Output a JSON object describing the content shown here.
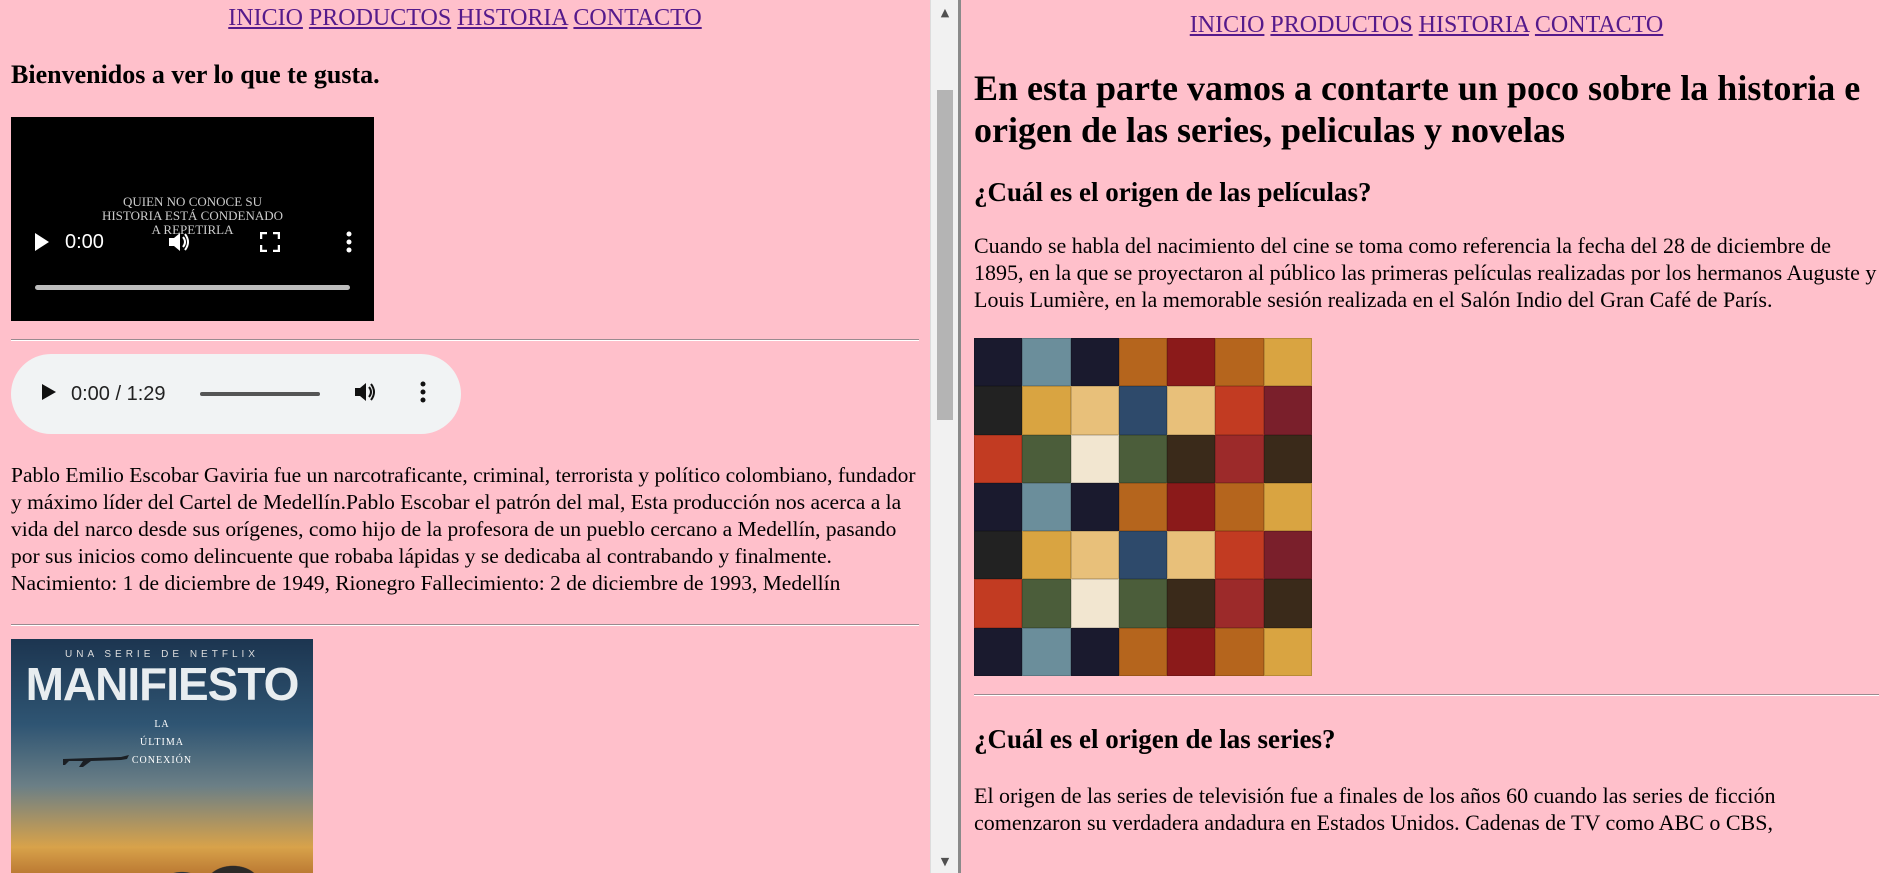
{
  "left": {
    "nav": [
      "INICIO",
      "PRODUCTOS",
      "HISTORIA",
      "CONTACTO"
    ],
    "welcome": "Bienvenidos a ver lo que te gusta.",
    "video": {
      "overlay_line1": "QUIEN NO CONOCE SU",
      "overlay_line2": "HISTORIA ESTÁ CONDENADO",
      "overlay_line3": "A REPETIRLA",
      "time": "0:00"
    },
    "audio": {
      "time": "0:00 / 1:29"
    },
    "bio": "Pablo Emilio Escobar Gaviria fue un narcotraficante, criminal, terrorista y político colombiano, fundador y máximo líder del Cartel de Medellín.Pablo Escobar el patrón del mal, Esta producción nos acerca a la vida del narco desde sus orígenes, como hijo de la profesora de un pueblo cercano a Medellín, pasando por sus inicios como delincuente que robaba lápidas y se dedicaba al contrabando y finalmente. Nacimiento: 1 de diciembre de 1949, Rionegro Fallecimiento: 2 de diciembre de 1993, Medellín",
    "poster": {
      "tag": "UNA SERIE DE NETFLIX",
      "title": "MANIFIESTO",
      "sub1": "LA",
      "sub2": "ÚLTIMA",
      "sub3": "CONEXIÓN"
    }
  },
  "right": {
    "nav": [
      "INICIO",
      "PRODUCTOS",
      "HISTORIA",
      "CONTACTO"
    ],
    "heading": "En esta parte vamos a contarte un poco sobre la historia e origen de las series, peliculas y novelas",
    "section1_title": "¿Cuál es el origen de las películas?",
    "section1_text": "Cuando se habla del nacimiento del cine se toma como referencia la fecha del 28 de diciembre de 1895, en la que se proyectaron al público las primeras películas realizadas por los hermanos Auguste y Louis Lumière, en la memorable sesión realizada en el Salón Indio del Gran Café de París.",
    "section2_title": "¿Cuál es el origen de las series?",
    "section2_text": "El origen de las series de televisión fue a finales de los años 60 cuando las series de ficción comenzaron su verdadera andadura en Estados Unidos. Cadenas de TV como ABC o CBS,"
  },
  "colors": {
    "background": "#ffc0cb",
    "link": "#551a8b",
    "video_bg": "#000000",
    "audio_bg": "#f1f3f4"
  },
  "icons": [
    "play-icon",
    "volume-icon",
    "fullscreen-icon",
    "more-options-icon",
    "scroll-up-icon",
    "scroll-down-icon"
  ]
}
